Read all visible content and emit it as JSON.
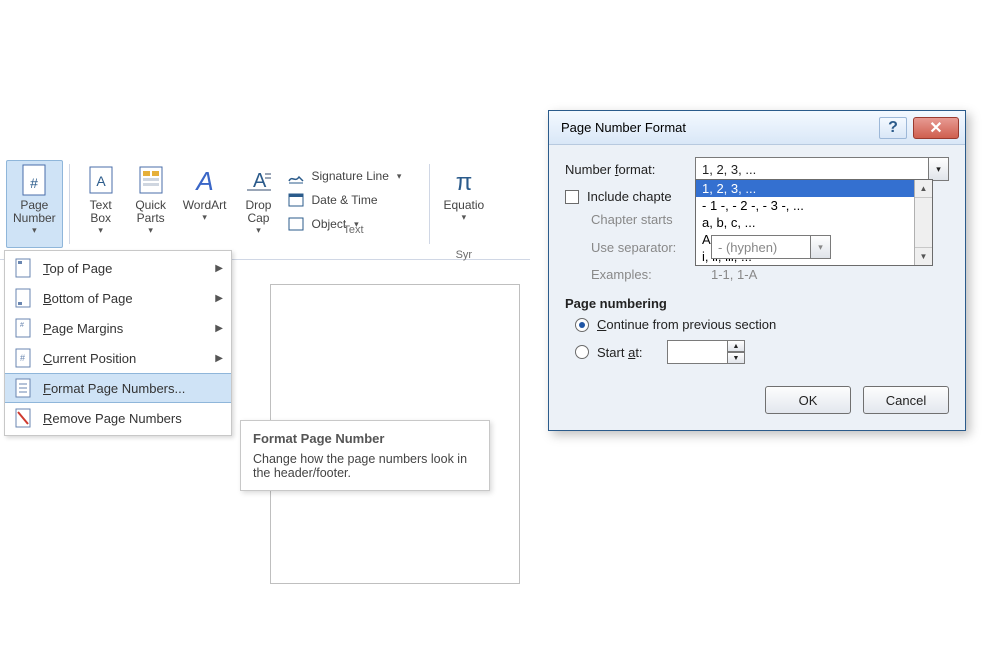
{
  "ribbon": {
    "buttons": {
      "page_number": "Page\nNumber",
      "text_box": "Text\nBox",
      "quick_parts": "Quick\nParts",
      "wordart": "WordArt",
      "drop_cap": "Drop\nCap",
      "signature_line": "Signature Line",
      "date_time": "Date & Time",
      "object": "Object",
      "equation": "Equatio"
    },
    "group_text": "Text",
    "group_symbols": "Syr"
  },
  "menu": {
    "items": [
      {
        "key": "top",
        "label": "Top of Page",
        "submenu": true
      },
      {
        "key": "bot",
        "label": "Bottom of Page",
        "submenu": true
      },
      {
        "key": "marg",
        "label": "Page Margins",
        "submenu": true
      },
      {
        "key": "cur",
        "label": "Current Position",
        "submenu": true
      },
      {
        "key": "fmt",
        "label": "Format Page Numbers...",
        "submenu": false
      },
      {
        "key": "rem",
        "label": "Remove Page Numbers",
        "submenu": false
      }
    ],
    "underline_chars": {
      "top": "T",
      "bot": "B",
      "marg": "P",
      "cur": "C",
      "fmt": "F",
      "rem": "R"
    }
  },
  "tooltip": {
    "title": "Format Page Number",
    "body": "Change how the page numbers look in the header/footer."
  },
  "dialog": {
    "title": "Page Number Format",
    "labels": {
      "number_format": "Number format:",
      "include_chapter": "Include chapte",
      "chapter_starts": "Chapter starts",
      "use_separator": "Use separator:",
      "examples_label": "Examples:",
      "examples_value": "1-1, 1-A",
      "page_numbering": "Page numbering",
      "continue": "Continue from previous section",
      "start_at": "Start at:",
      "ok": "OK",
      "cancel": "Cancel",
      "separator_value": "-   (hyphen)"
    },
    "number_format_value": "1, 2, 3, ...",
    "format_options": [
      "1, 2, 3, ...",
      "- 1 -, - 2 -, - 3 -, ...",
      "a, b, c, ...",
      "A, B, C, ...",
      "i, ii, iii, ..."
    ],
    "radio_selected": "continue",
    "start_at_value": ""
  }
}
